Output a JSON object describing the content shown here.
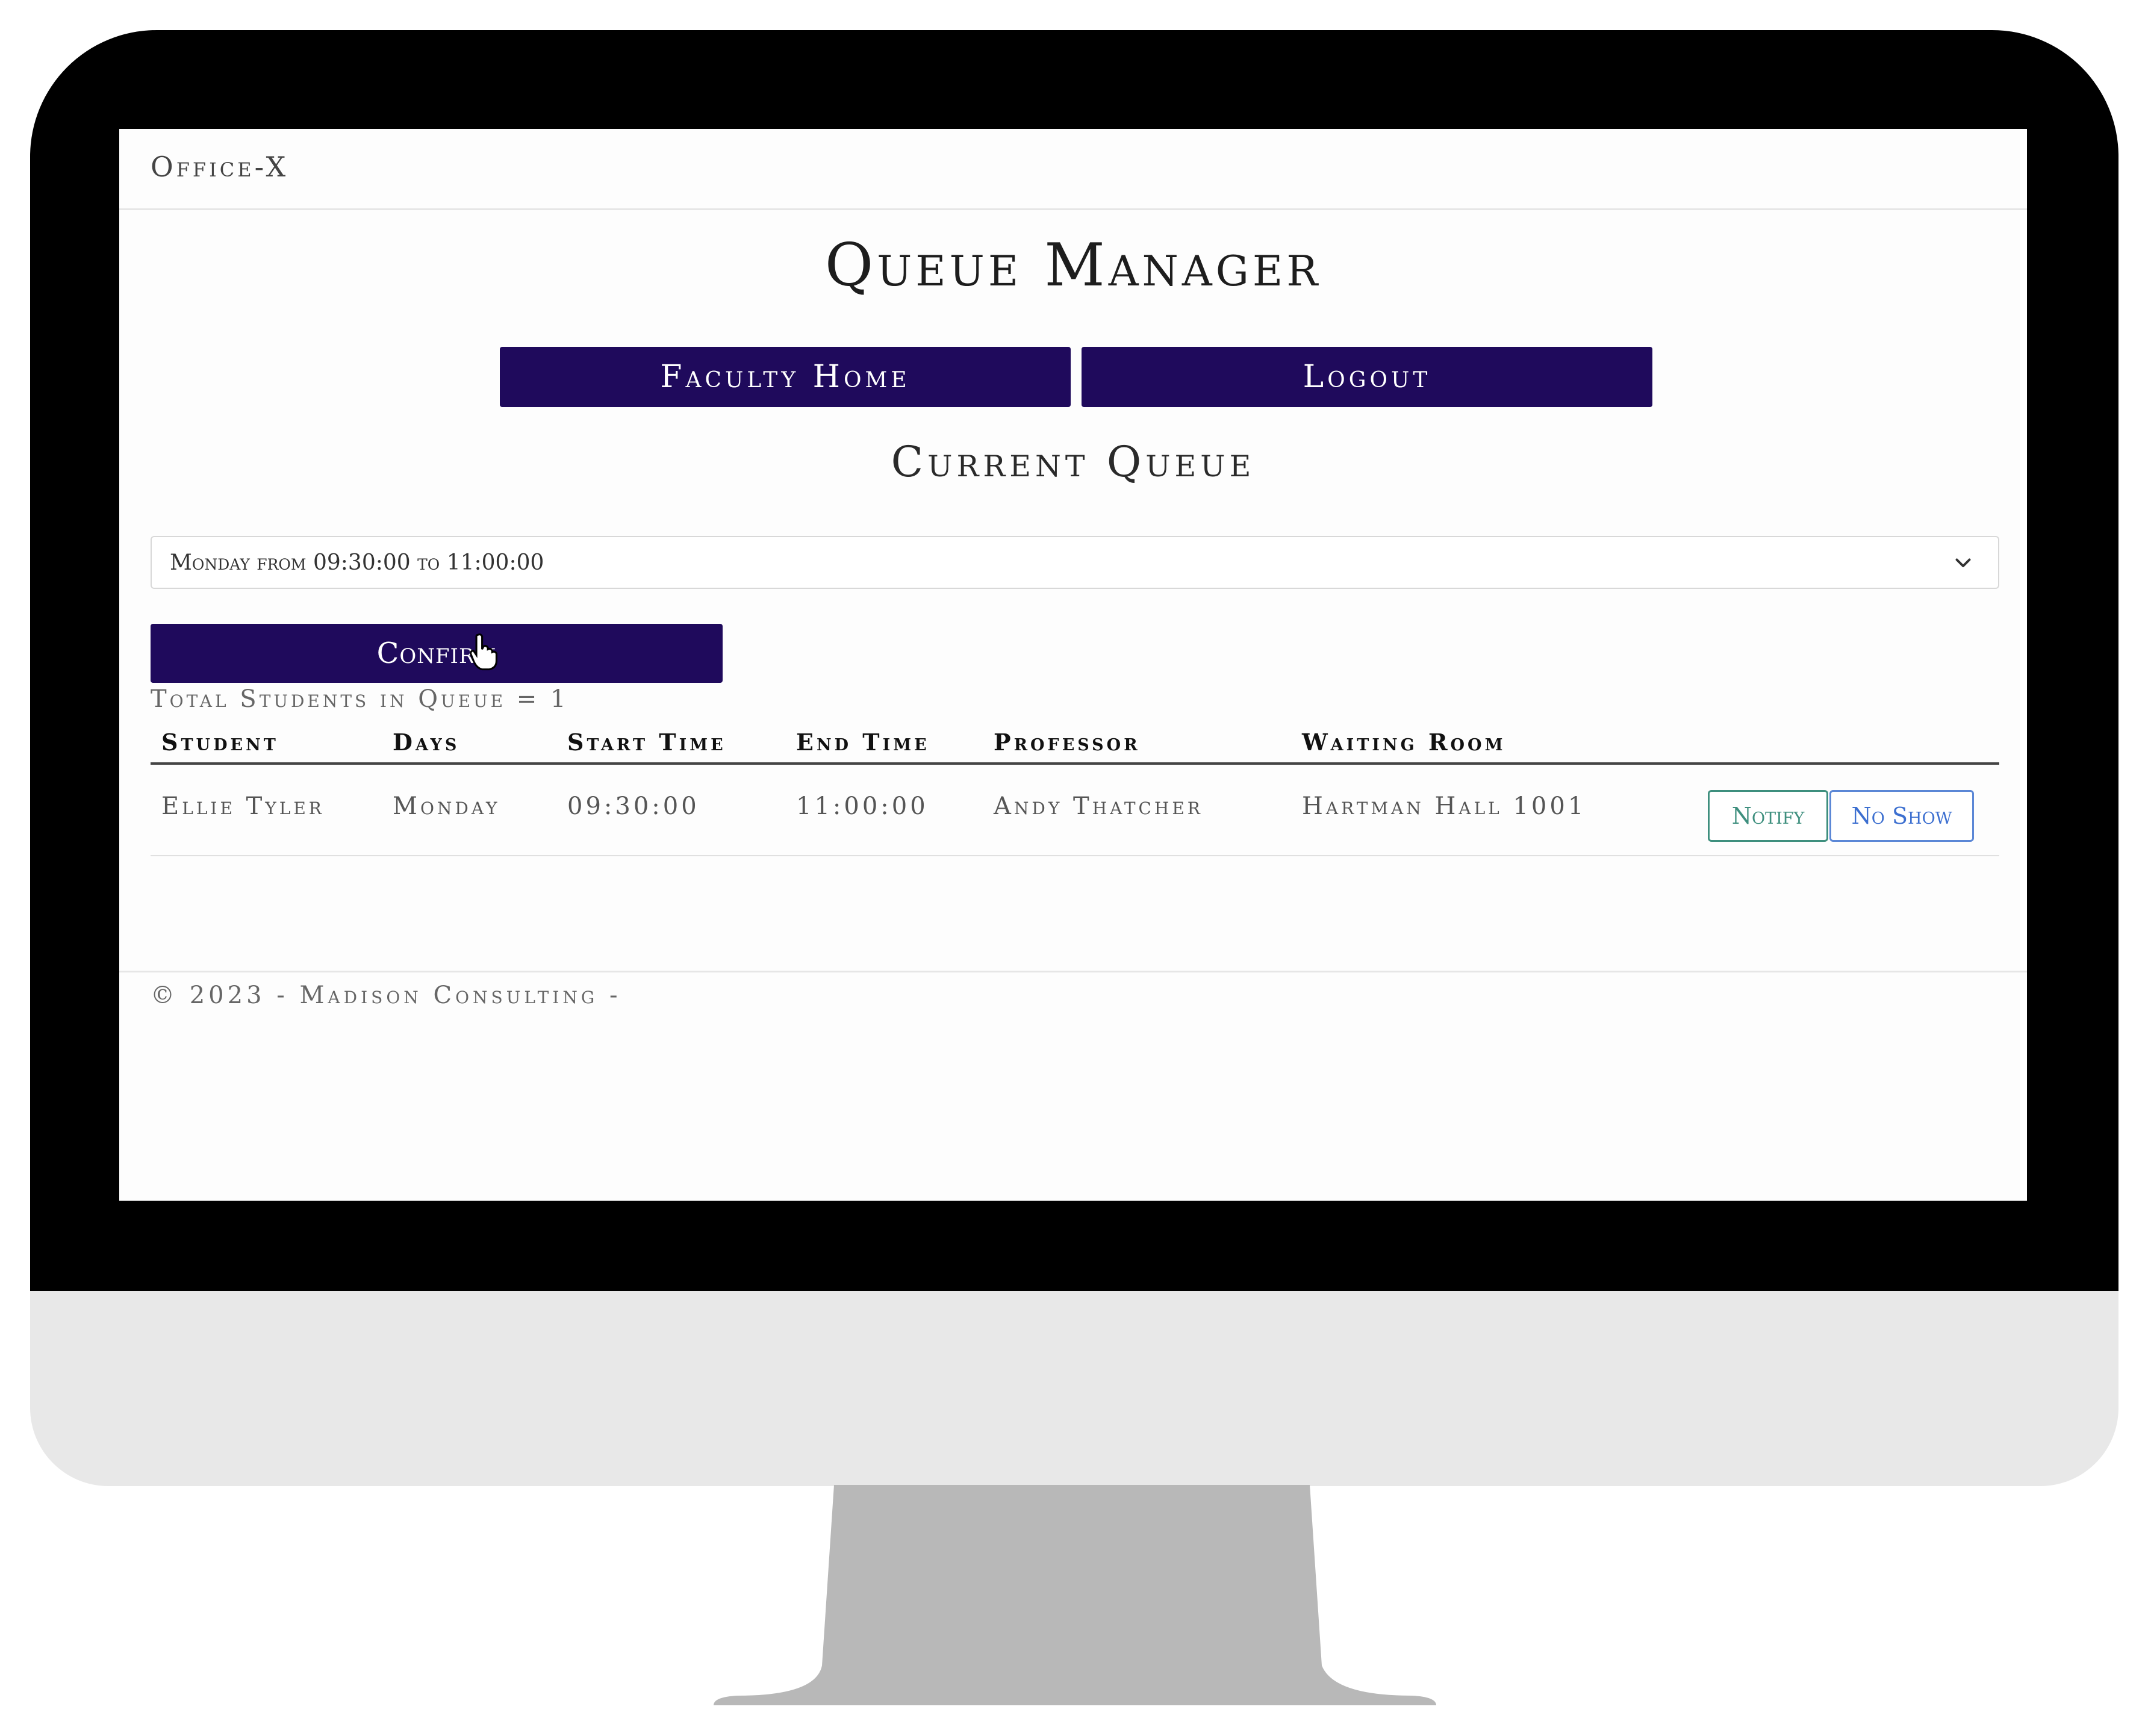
{
  "app": {
    "brand": "Office-X"
  },
  "page": {
    "title": "Queue Manager",
    "subtitle": "Current Queue"
  },
  "nav": {
    "faculty_home_label": "Faculty Home",
    "logout_label": "Logout"
  },
  "schedule_select": {
    "selected": "Monday from 09:30:00 to 11:00:00"
  },
  "confirm_label": "Confirm",
  "queue": {
    "total_text": "Total Students in Queue = 1",
    "columns": [
      "Student",
      "Days",
      "Start Time",
      "End Time",
      "Professor",
      "Waiting Room"
    ],
    "rows": [
      {
        "student": "Ellie Tyler",
        "days": "Monday",
        "start_time": "09:30:00",
        "end_time": "11:00:00",
        "professor": "Andy Thatcher",
        "waiting_room": "Hartman Hall 1001",
        "notify_label": "Notify",
        "no_show_label": "No Show"
      }
    ]
  },
  "footer": {
    "text": "© 2023 - Madison Consulting -"
  },
  "colors": {
    "primary": "#1f0a5c",
    "notify": "#3e8f7e",
    "no_show": "#3c6fd0",
    "bezel": "#000000",
    "chin": "#e8e8e8",
    "stand": "#b8b8b8"
  },
  "icons": {
    "select_chevron": "chevron-down-icon",
    "pointer": "hand-pointer-icon"
  }
}
